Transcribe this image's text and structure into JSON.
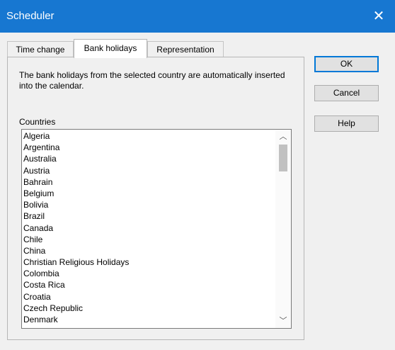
{
  "window": {
    "title": "Scheduler",
    "close_glyph": "✕",
    "close_icon": "close-icon"
  },
  "tabs": [
    {
      "label": "Time change",
      "active": false
    },
    {
      "label": "Bank holidays",
      "active": true
    },
    {
      "label": "Representation",
      "active": false
    }
  ],
  "panel": {
    "description": "The bank holidays from the selected country are automatically inserted into the calendar.",
    "list_label": "Countries"
  },
  "countries": [
    "Algeria",
    "Argentina",
    "Australia",
    "Austria",
    "Bahrain",
    "Belgium",
    "Bolivia",
    "Brazil",
    "Canada",
    "Chile",
    "China",
    "Christian Religious Holidays",
    "Colombia",
    "Costa Rica",
    "Croatia",
    "Czech Republic",
    "Denmark"
  ],
  "scrollbar": {
    "up_glyph": "︿",
    "down_glyph": "﹀"
  },
  "buttons": {
    "ok": "OK",
    "cancel": "Cancel",
    "help": "Help"
  },
  "colors": {
    "titlebar": "#1777d1",
    "default_button_border": "#0078d7"
  }
}
